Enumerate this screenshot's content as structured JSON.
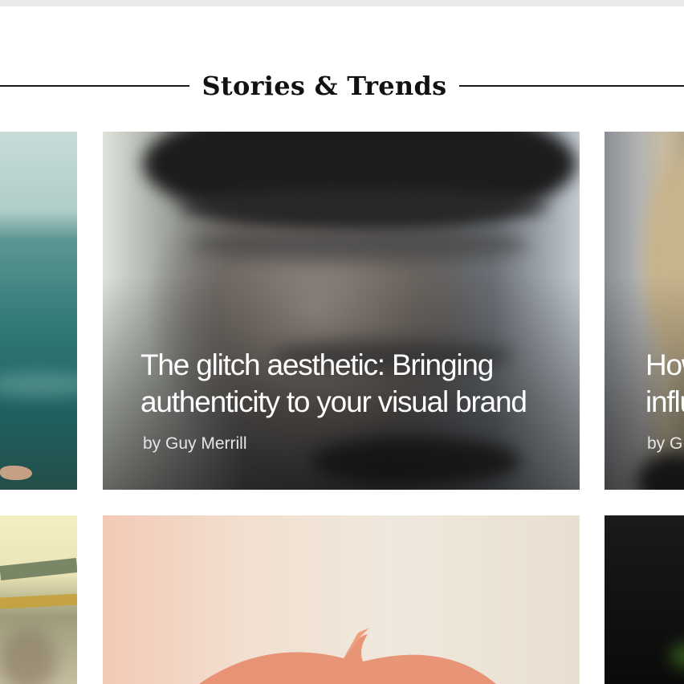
{
  "section": {
    "title": "Stories & Trends"
  },
  "cards": [
    {
      "title": "",
      "author": ""
    },
    {
      "title_lines": [
        "The glitch aesthetic: Bringing",
        "authenticity to your visual brand"
      ],
      "author": "by Guy Merrill"
    },
    {
      "title_lines": [
        "How",
        "influ"
      ],
      "author": "by G"
    }
  ],
  "colors": {
    "heading_text": "#111111",
    "rule": "#1a1a1a",
    "card_text": "#ffffff"
  }
}
